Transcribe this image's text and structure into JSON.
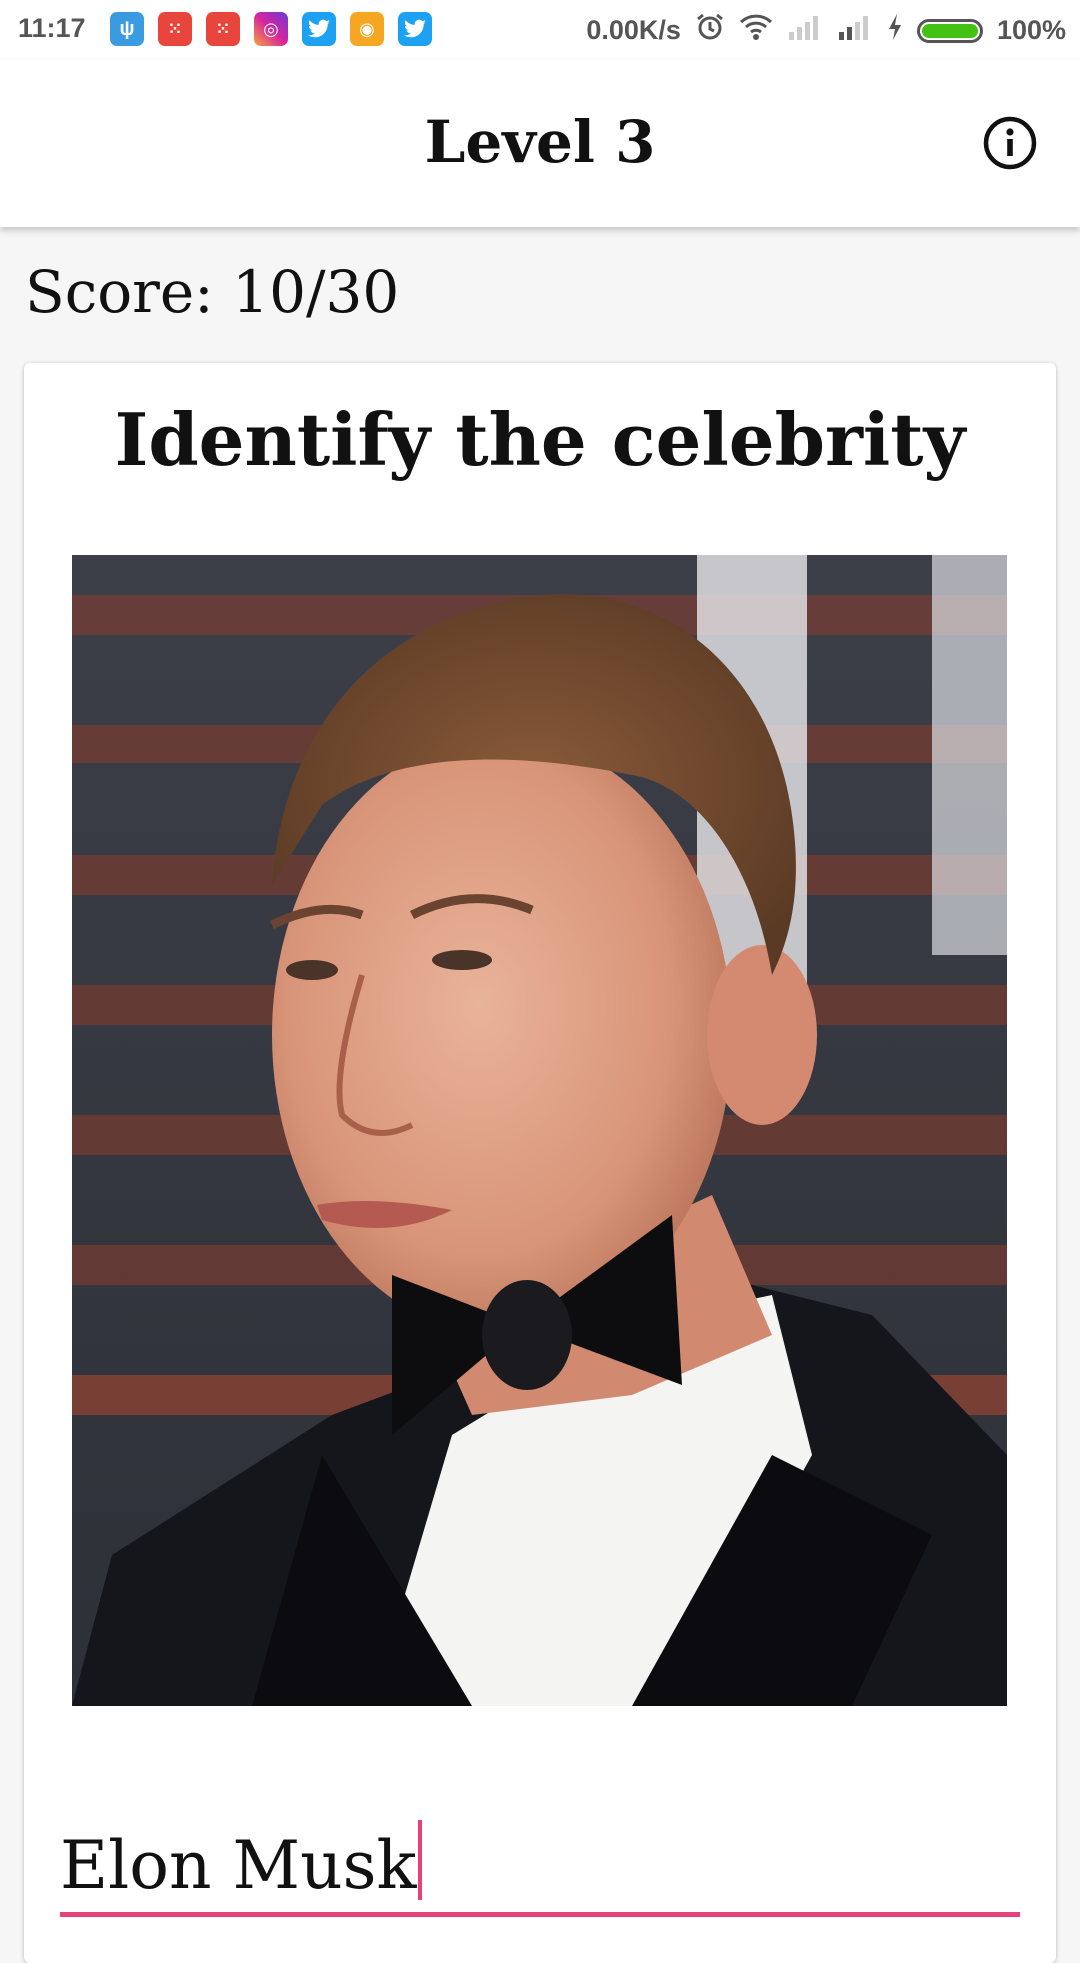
{
  "status_bar": {
    "time": "11:17",
    "network_speed": "0.00K/s",
    "battery_percent": "100%",
    "battery_level": 1.0,
    "notification_icons": [
      "usb-icon",
      "grid-app-icon",
      "grid-app-icon",
      "instagram-icon",
      "twitter-icon",
      "chat-icon",
      "twitter-icon"
    ],
    "system_icons": [
      "alarm-icon",
      "wifi-icon",
      "signal-icon",
      "signal-icon",
      "charging-icon",
      "battery-icon"
    ]
  },
  "app_bar": {
    "title": "Level 3",
    "info_icon": "info-icon"
  },
  "score": {
    "text": "Score: 10/30"
  },
  "card": {
    "question": "Identify the celebrity",
    "answer_value": "Elon Musk"
  },
  "colors": {
    "accent": "#e8407a",
    "battery_green": "#43c214",
    "background": "#f6f6f6",
    "card": "#ffffff"
  }
}
